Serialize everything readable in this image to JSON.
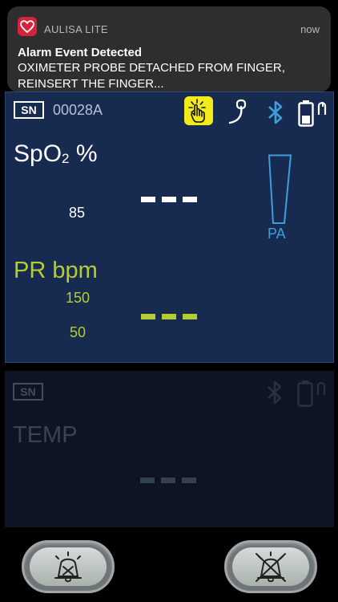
{
  "notification": {
    "app_name": "AULISA LITE",
    "time": "now",
    "title": "Alarm Event Detected",
    "body": "OXIMETER PROBE DETACHED FROM FINGER, REINSERT THE FINGER...",
    "icon": "heart-icon"
  },
  "device": {
    "sn_label": "SN",
    "serial": "00028A",
    "icons": [
      "hand-touch-icon",
      "probe-icon",
      "bluetooth-icon",
      "battery-icon"
    ]
  },
  "spo2": {
    "label_main": "SpO",
    "label_sub": "2",
    "label_unit": " %",
    "alarm_low": "85",
    "reading": "---"
  },
  "pa": {
    "label": "PA"
  },
  "pr": {
    "label": "PR bpm",
    "alarm_high": "150",
    "alarm_low": "50",
    "reading": "---"
  },
  "temp": {
    "sn_label": "SN",
    "label": "TEMP",
    "reading": "---"
  },
  "colors": {
    "panel_bg": "#172a4f",
    "accent_yellow": "#f2ea1a",
    "pr_green": "#b5ce2f",
    "bluetooth_blue": "#3f9ddb"
  },
  "bottom_buttons": [
    "alarm-silence-icon",
    "alarm-off-icon"
  ]
}
